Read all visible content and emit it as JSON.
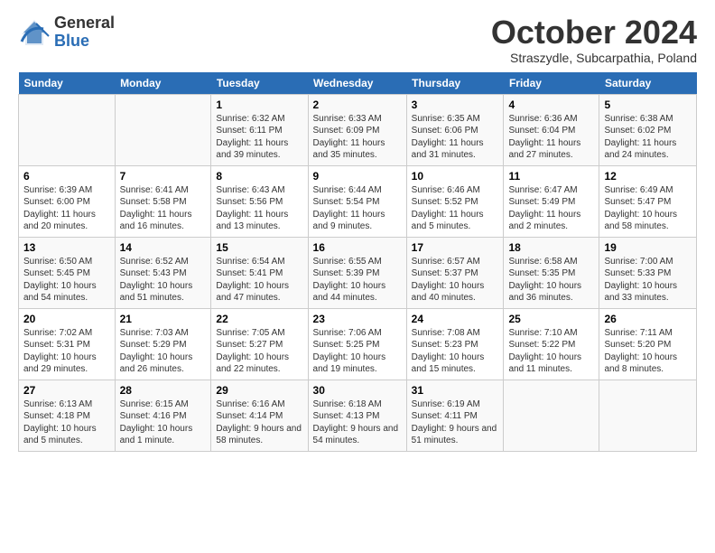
{
  "logo": {
    "general": "General",
    "blue": "Blue"
  },
  "title": "October 2024",
  "subtitle": "Straszydle, Subcarpathia, Poland",
  "days_of_week": [
    "Sunday",
    "Monday",
    "Tuesday",
    "Wednesday",
    "Thursday",
    "Friday",
    "Saturday"
  ],
  "weeks": [
    [
      {
        "num": "",
        "info": ""
      },
      {
        "num": "",
        "info": ""
      },
      {
        "num": "1",
        "info": "Sunrise: 6:32 AM\nSunset: 6:11 PM\nDaylight: 11 hours and 39 minutes."
      },
      {
        "num": "2",
        "info": "Sunrise: 6:33 AM\nSunset: 6:09 PM\nDaylight: 11 hours and 35 minutes."
      },
      {
        "num": "3",
        "info": "Sunrise: 6:35 AM\nSunset: 6:06 PM\nDaylight: 11 hours and 31 minutes."
      },
      {
        "num": "4",
        "info": "Sunrise: 6:36 AM\nSunset: 6:04 PM\nDaylight: 11 hours and 27 minutes."
      },
      {
        "num": "5",
        "info": "Sunrise: 6:38 AM\nSunset: 6:02 PM\nDaylight: 11 hours and 24 minutes."
      }
    ],
    [
      {
        "num": "6",
        "info": "Sunrise: 6:39 AM\nSunset: 6:00 PM\nDaylight: 11 hours and 20 minutes."
      },
      {
        "num": "7",
        "info": "Sunrise: 6:41 AM\nSunset: 5:58 PM\nDaylight: 11 hours and 16 minutes."
      },
      {
        "num": "8",
        "info": "Sunrise: 6:43 AM\nSunset: 5:56 PM\nDaylight: 11 hours and 13 minutes."
      },
      {
        "num": "9",
        "info": "Sunrise: 6:44 AM\nSunset: 5:54 PM\nDaylight: 11 hours and 9 minutes."
      },
      {
        "num": "10",
        "info": "Sunrise: 6:46 AM\nSunset: 5:52 PM\nDaylight: 11 hours and 5 minutes."
      },
      {
        "num": "11",
        "info": "Sunrise: 6:47 AM\nSunset: 5:49 PM\nDaylight: 11 hours and 2 minutes."
      },
      {
        "num": "12",
        "info": "Sunrise: 6:49 AM\nSunset: 5:47 PM\nDaylight: 10 hours and 58 minutes."
      }
    ],
    [
      {
        "num": "13",
        "info": "Sunrise: 6:50 AM\nSunset: 5:45 PM\nDaylight: 10 hours and 54 minutes."
      },
      {
        "num": "14",
        "info": "Sunrise: 6:52 AM\nSunset: 5:43 PM\nDaylight: 10 hours and 51 minutes."
      },
      {
        "num": "15",
        "info": "Sunrise: 6:54 AM\nSunset: 5:41 PM\nDaylight: 10 hours and 47 minutes."
      },
      {
        "num": "16",
        "info": "Sunrise: 6:55 AM\nSunset: 5:39 PM\nDaylight: 10 hours and 44 minutes."
      },
      {
        "num": "17",
        "info": "Sunrise: 6:57 AM\nSunset: 5:37 PM\nDaylight: 10 hours and 40 minutes."
      },
      {
        "num": "18",
        "info": "Sunrise: 6:58 AM\nSunset: 5:35 PM\nDaylight: 10 hours and 36 minutes."
      },
      {
        "num": "19",
        "info": "Sunrise: 7:00 AM\nSunset: 5:33 PM\nDaylight: 10 hours and 33 minutes."
      }
    ],
    [
      {
        "num": "20",
        "info": "Sunrise: 7:02 AM\nSunset: 5:31 PM\nDaylight: 10 hours and 29 minutes."
      },
      {
        "num": "21",
        "info": "Sunrise: 7:03 AM\nSunset: 5:29 PM\nDaylight: 10 hours and 26 minutes."
      },
      {
        "num": "22",
        "info": "Sunrise: 7:05 AM\nSunset: 5:27 PM\nDaylight: 10 hours and 22 minutes."
      },
      {
        "num": "23",
        "info": "Sunrise: 7:06 AM\nSunset: 5:25 PM\nDaylight: 10 hours and 19 minutes."
      },
      {
        "num": "24",
        "info": "Sunrise: 7:08 AM\nSunset: 5:23 PM\nDaylight: 10 hours and 15 minutes."
      },
      {
        "num": "25",
        "info": "Sunrise: 7:10 AM\nSunset: 5:22 PM\nDaylight: 10 hours and 11 minutes."
      },
      {
        "num": "26",
        "info": "Sunrise: 7:11 AM\nSunset: 5:20 PM\nDaylight: 10 hours and 8 minutes."
      }
    ],
    [
      {
        "num": "27",
        "info": "Sunrise: 6:13 AM\nSunset: 4:18 PM\nDaylight: 10 hours and 5 minutes."
      },
      {
        "num": "28",
        "info": "Sunrise: 6:15 AM\nSunset: 4:16 PM\nDaylight: 10 hours and 1 minute."
      },
      {
        "num": "29",
        "info": "Sunrise: 6:16 AM\nSunset: 4:14 PM\nDaylight: 9 hours and 58 minutes."
      },
      {
        "num": "30",
        "info": "Sunrise: 6:18 AM\nSunset: 4:13 PM\nDaylight: 9 hours and 54 minutes."
      },
      {
        "num": "31",
        "info": "Sunrise: 6:19 AM\nSunset: 4:11 PM\nDaylight: 9 hours and 51 minutes."
      },
      {
        "num": "",
        "info": ""
      },
      {
        "num": "",
        "info": ""
      }
    ]
  ]
}
